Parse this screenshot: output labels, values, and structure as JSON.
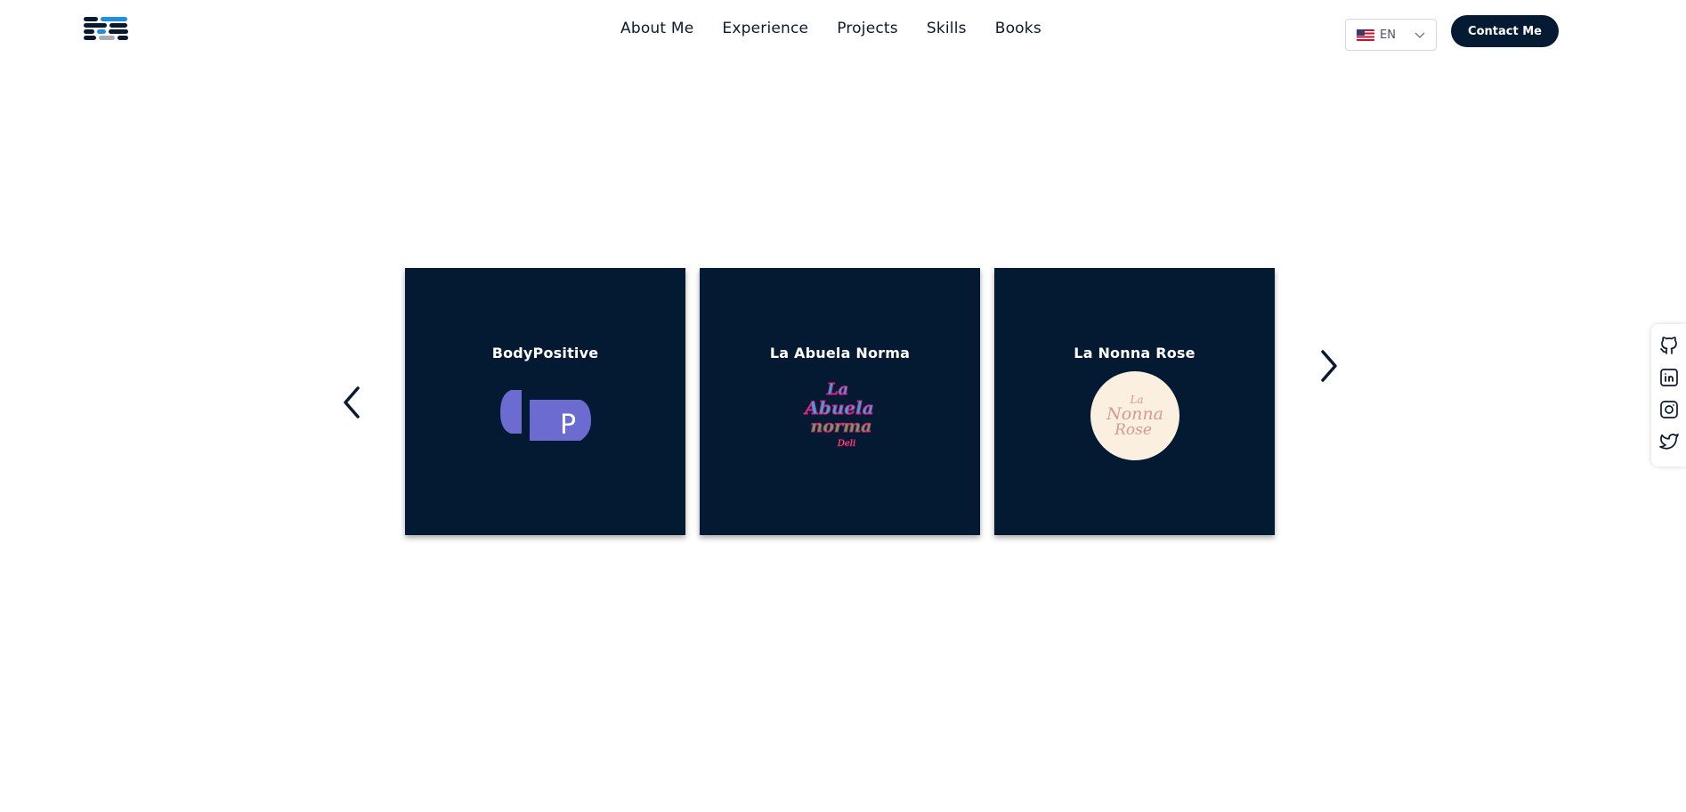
{
  "header": {
    "logo_name": "brand-logo",
    "nav": [
      {
        "label": "About Me"
      },
      {
        "label": "Experience"
      },
      {
        "label": "Projects"
      },
      {
        "label": "Skills"
      },
      {
        "label": "Books"
      }
    ],
    "language": {
      "code": "EN",
      "flag_icon": "us-flag-icon"
    },
    "contact_label": "Contact Me"
  },
  "carousel": {
    "prev_icon": "chevron-left-icon",
    "next_icon": "chevron-right-icon",
    "cards": [
      {
        "title": "BodyPositive",
        "logo_letter": "P"
      },
      {
        "title": "La Abuela Norma",
        "logo_lines": [
          "La",
          "Abuela",
          "norma",
          "Deli"
        ]
      },
      {
        "title": "La Nonna Rose",
        "logo_lines": [
          "La",
          "Nonna",
          "Rose"
        ]
      }
    ]
  },
  "social": [
    "github-icon",
    "linkedin-icon",
    "instagram-icon",
    "twitter-icon"
  ],
  "colors": {
    "navy": "#041a33",
    "accent_blue": "#1a8fe3",
    "purple": "#6b6bd0",
    "cream": "#fbf0e0"
  }
}
